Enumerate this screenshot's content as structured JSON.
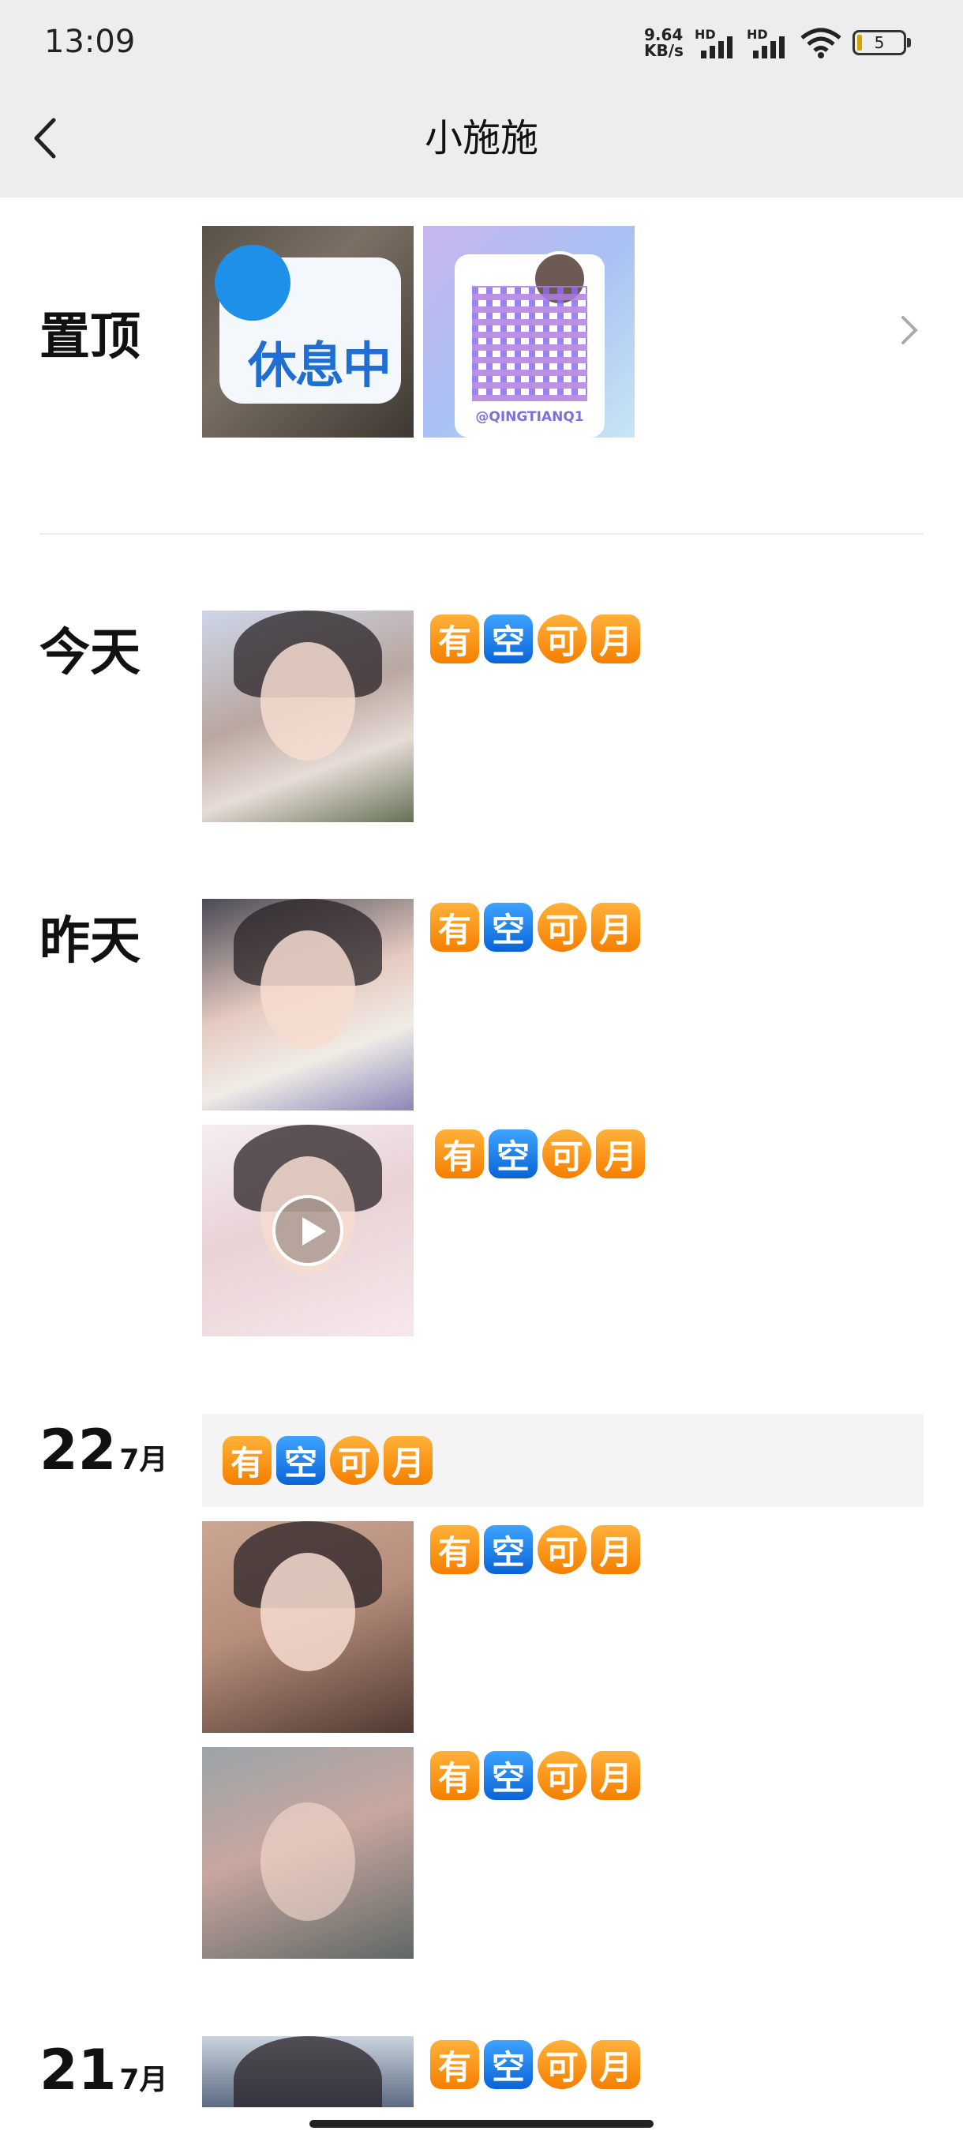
{
  "status_bar": {
    "time": "13:09",
    "net_speed_value": "9.64",
    "net_speed_unit": "KB/s",
    "signal1_label": "HD",
    "signal2_label": "HD",
    "battery_level": "5"
  },
  "header": {
    "title": "小施施"
  },
  "pinned": {
    "label": "置顶",
    "items": [
      {
        "sign_text": "休息中"
      },
      {
        "handle": "@QINGTIANQ1"
      }
    ]
  },
  "sections": [
    {
      "label": "今天",
      "posts": [
        {
          "emoji": [
            "有",
            "空",
            "可",
            "月"
          ]
        }
      ]
    },
    {
      "label": "昨天",
      "posts": [
        {
          "emoji": [
            "有",
            "空",
            "可",
            "月"
          ]
        },
        {
          "emoji": [
            "有",
            "空",
            "可",
            "月"
          ],
          "video": true
        }
      ]
    },
    {
      "day": "22",
      "month": "7月",
      "posts": [
        {
          "emoji": [
            "有",
            "空",
            "可",
            "月"
          ],
          "text_only": true
        },
        {
          "emoji": [
            "有",
            "空",
            "可",
            "月"
          ]
        },
        {
          "emoji": [
            "有",
            "空",
            "可",
            "月"
          ]
        }
      ]
    },
    {
      "day": "21",
      "month": "7月",
      "posts": [
        {
          "emoji": [
            "有",
            "空",
            "可",
            "月"
          ]
        }
      ]
    }
  ],
  "colors": {
    "header_bg": "#ededed",
    "emoji_orange": "#f57f00",
    "emoji_blue": "#0a64d6",
    "text_post_bg": "#f4f4f4"
  }
}
